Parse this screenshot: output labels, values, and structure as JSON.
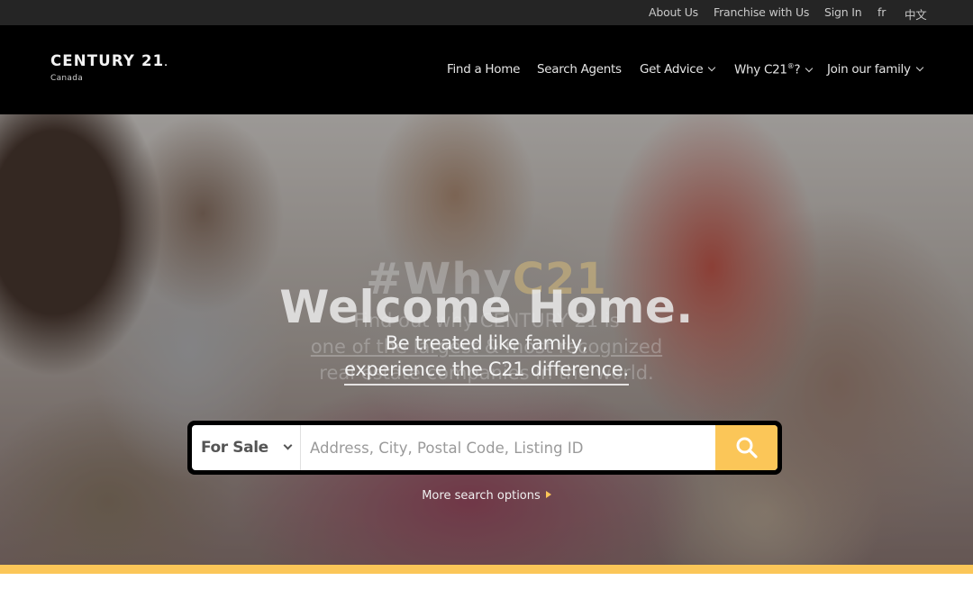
{
  "utility_nav": {
    "items": [
      {
        "label": "About Us"
      },
      {
        "label": "Franchise with Us"
      },
      {
        "label": "Sign In"
      },
      {
        "label": "fr"
      },
      {
        "label": "中文"
      }
    ]
  },
  "brand": {
    "name": "CENTURY 21",
    "mark": ".",
    "region": "Canada"
  },
  "main_nav": {
    "items": [
      {
        "label": "Find a Home",
        "has_dropdown": false
      },
      {
        "label": "Search Agents",
        "has_dropdown": false
      },
      {
        "label": "Get Advice",
        "has_dropdown": true
      },
      {
        "label": "Why C21",
        "superscript": "®",
        "suffix": "?",
        "has_dropdown": true
      },
      {
        "label": "Join our family",
        "has_dropdown": true
      }
    ]
  },
  "hero": {
    "slides": [
      {
        "title": "Welcome Home.",
        "lines": [
          "Be treated like family,",
          "experience the C21 difference."
        ],
        "state": "active"
      },
      {
        "title_prefix": "#Why",
        "title_accent": "C21",
        "lines": [
          "Find out why CENTURY 21 is",
          "one of the largest & most recognized",
          "real estate companies in the world."
        ],
        "state": "fading"
      }
    ]
  },
  "search": {
    "type_selected": "For Sale",
    "placeholder": "Address, City, Postal Code, Listing ID",
    "value": "",
    "button_icon": "search-icon",
    "more_options_label": "More search options"
  },
  "colors": {
    "accent": "#fbc658",
    "topbar_bg": "#252525",
    "nav_bg": "#000000"
  }
}
